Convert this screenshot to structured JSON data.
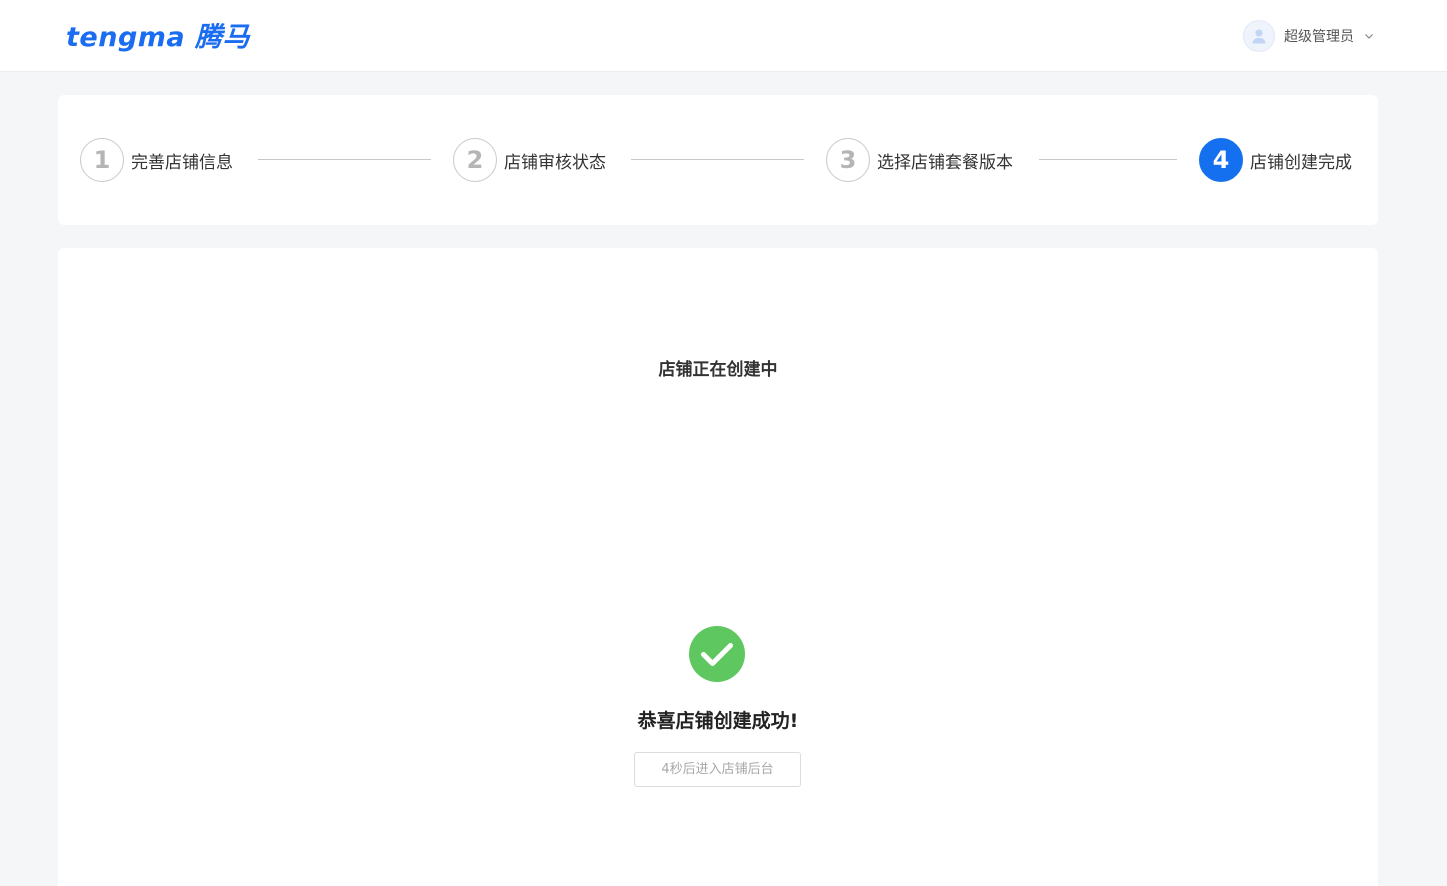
{
  "header": {
    "logo_text": "tengma 腾马",
    "user_name": "超级管理员",
    "avatar_icon": "user-avatar-icon",
    "dropdown_icon": "chevron-down-icon"
  },
  "steps": [
    {
      "number": "1",
      "label": "完善店铺信息",
      "active": false
    },
    {
      "number": "2",
      "label": "店铺审核状态",
      "active": false
    },
    {
      "number": "3",
      "label": "选择店铺套餐版本",
      "active": false
    },
    {
      "number": "4",
      "label": "店铺创建完成",
      "active": true
    }
  ],
  "main": {
    "status_text": "店铺正在创建中",
    "success_icon": "check-circle-icon",
    "success_title": "恭喜店铺创建成功!",
    "enter_button_label": "4秒后进入店铺后台"
  },
  "colors": {
    "brand": "#1a6cf0",
    "active_step": "#1570ef",
    "success": "#5fc75f",
    "page_bg": "#f5f6f8"
  }
}
